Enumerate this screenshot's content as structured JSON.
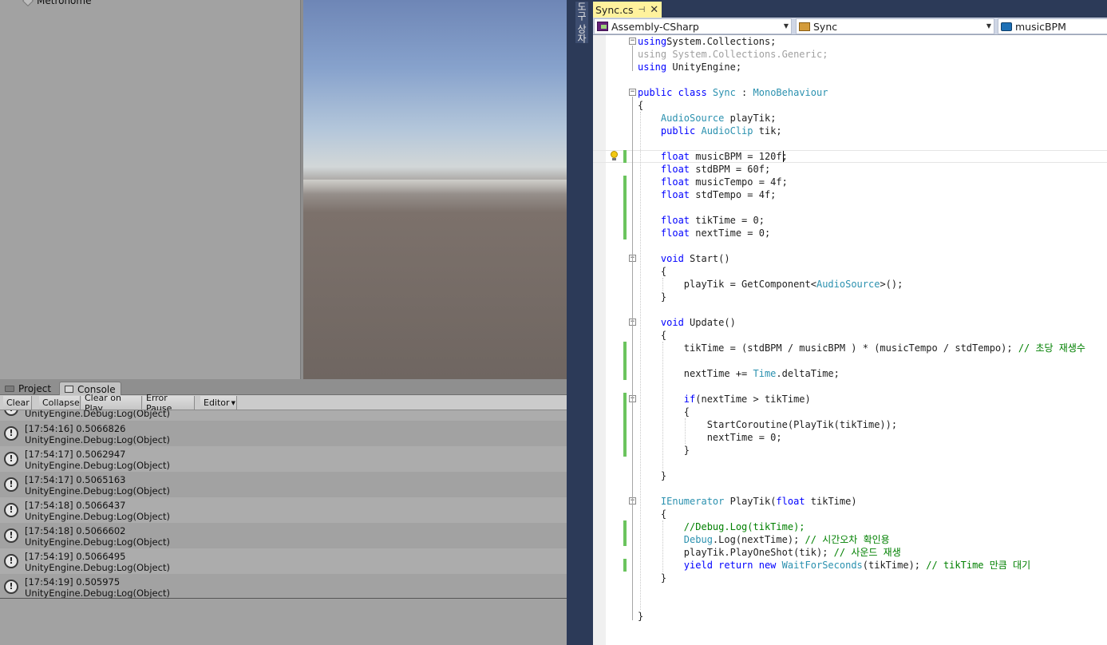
{
  "hierarchy": {
    "item_label": "Metronome"
  },
  "unity": {
    "tabs": [
      {
        "label": "Project"
      },
      {
        "label": "Console"
      }
    ],
    "toolbar": {
      "clear": "Clear",
      "collapse": "Collapse",
      "clear_on_play": "Clear on Play",
      "error_pause": "Error Pause",
      "editor": "Editor"
    },
    "log_partial": "UnityEngine.Debug:Log(Object)",
    "logs": [
      {
        "line1": "[17:54:16] 0.5066826",
        "line2": "UnityEngine.Debug:Log(Object)"
      },
      {
        "line1": "[17:54:17] 0.5062947",
        "line2": "UnityEngine.Debug:Log(Object)"
      },
      {
        "line1": "[17:54:17] 0.5065163",
        "line2": "UnityEngine.Debug:Log(Object)"
      },
      {
        "line1": "[17:54:18] 0.5066437",
        "line2": "UnityEngine.Debug:Log(Object)"
      },
      {
        "line1": "[17:54:18] 0.5066602",
        "line2": "UnityEngine.Debug:Log(Object)"
      },
      {
        "line1": "[17:54:19] 0.5066495",
        "line2": "UnityEngine.Debug:Log(Object)"
      },
      {
        "line1": "[17:54:19] 0.505975",
        "line2": "UnityEngine.Debug:Log(Object)"
      }
    ]
  },
  "vs": {
    "side_tab": "도구 상자",
    "file_tab": "Sync.cs",
    "nav": {
      "project": "Assembly-CSharp",
      "class": "Sync",
      "member": "musicBPM"
    },
    "code": [
      [
        [
          "kw",
          "using"
        ],
        [
          "",
          "System.Collections;"
        ]
      ],
      [
        [
          "gr",
          "using System.Collections.Generic;"
        ]
      ],
      [
        [
          "kw",
          "using"
        ],
        [
          "",
          " UnityEngine;"
        ]
      ],
      [],
      [
        [
          "kw",
          "public class "
        ],
        [
          "ty",
          "Sync"
        ],
        [
          "",
          " : "
        ],
        [
          "ty",
          "MonoBehaviour"
        ]
      ],
      [
        [
          "",
          "{"
        ]
      ],
      [
        [
          "",
          "    "
        ],
        [
          "ty",
          "AudioSource"
        ],
        [
          "",
          " playTik;"
        ]
      ],
      [
        [
          "",
          "    "
        ],
        [
          "kw",
          "public "
        ],
        [
          "ty",
          "AudioClip"
        ],
        [
          "",
          " tik;"
        ]
      ],
      [],
      [
        [
          "",
          "    "
        ],
        [
          "kw",
          "float"
        ],
        [
          "",
          " musicBPM = 120f;"
        ]
      ],
      [
        [
          "",
          "    "
        ],
        [
          "kw",
          "float"
        ],
        [
          "",
          " stdBPM = 60f;"
        ]
      ],
      [
        [
          "",
          "    "
        ],
        [
          "kw",
          "float"
        ],
        [
          "",
          " musicTempo = 4f;"
        ]
      ],
      [
        [
          "",
          "    "
        ],
        [
          "kw",
          "float"
        ],
        [
          "",
          " stdTempo = 4f;"
        ]
      ],
      [],
      [
        [
          "",
          "    "
        ],
        [
          "kw",
          "float"
        ],
        [
          "",
          " tikTime = 0;"
        ]
      ],
      [
        [
          "",
          "    "
        ],
        [
          "kw",
          "float"
        ],
        [
          "",
          " nextTime = 0;"
        ]
      ],
      [],
      [
        [
          "",
          "    "
        ],
        [
          "kw",
          "void"
        ],
        [
          "",
          " Start()"
        ]
      ],
      [
        [
          "",
          "    {"
        ]
      ],
      [
        [
          "",
          "        playTik = GetComponent<"
        ],
        [
          "ty",
          "AudioSource"
        ],
        [
          "",
          ">();"
        ]
      ],
      [
        [
          "",
          "    }"
        ]
      ],
      [],
      [
        [
          "",
          "    "
        ],
        [
          "kw",
          "void"
        ],
        [
          "",
          " Update()"
        ]
      ],
      [
        [
          "",
          "    {"
        ]
      ],
      [
        [
          "",
          "        tikTime = (stdBPM / musicBPM ) * (musicTempo / stdTempo); "
        ],
        [
          "cm",
          "// 초당 재생수"
        ]
      ],
      [],
      [
        [
          "",
          "        nextTime += "
        ],
        [
          "ty",
          "Time"
        ],
        [
          "",
          ".deltaTime;"
        ]
      ],
      [],
      [
        [
          "",
          "        "
        ],
        [
          "kw",
          "if"
        ],
        [
          "",
          "(nextTime > tikTime)"
        ]
      ],
      [
        [
          "",
          "        {"
        ]
      ],
      [
        [
          "",
          "            StartCoroutine(PlayTik(tikTime));"
        ]
      ],
      [
        [
          "",
          "            nextTime = 0;"
        ]
      ],
      [
        [
          "",
          "        }"
        ]
      ],
      [],
      [
        [
          "",
          "    }"
        ]
      ],
      [],
      [
        [
          "",
          "    "
        ],
        [
          "ty",
          "IEnumerator"
        ],
        [
          "",
          " PlayTik("
        ],
        [
          "kw",
          "float"
        ],
        [
          "",
          " tikTime)"
        ]
      ],
      [
        [
          "",
          "    {"
        ]
      ],
      [
        [
          "",
          "        "
        ],
        [
          "cm",
          "//Debug.Log(tikTime);"
        ]
      ],
      [
        [
          "",
          "        "
        ],
        [
          "ty",
          "Debug"
        ],
        [
          "",
          ".Log(nextTime); "
        ],
        [
          "cm",
          "// 시간오차 확인용"
        ]
      ],
      [
        [
          "",
          "        playTik.PlayOneShot(tik); "
        ],
        [
          "cm",
          "// 사운드 재생"
        ]
      ],
      [
        [
          "",
          "        "
        ],
        [
          "kw",
          "yield return new "
        ],
        [
          "ty",
          "WaitForSeconds"
        ],
        [
          "",
          "(tikTime); "
        ],
        [
          "cm",
          "// tikTime 만큼 대기"
        ]
      ],
      [
        [
          "",
          "    }"
        ]
      ],
      [],
      [],
      [
        [
          "",
          "}"
        ]
      ]
    ]
  }
}
